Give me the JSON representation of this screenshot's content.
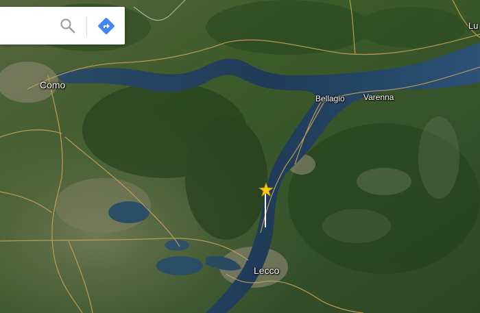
{
  "search": {
    "value": "",
    "placeholder": ""
  },
  "map": {
    "labels": {
      "como": "Como",
      "bellagio": "Bellagio",
      "varenna": "Varenna",
      "lecco": "Lecco",
      "lu": "Lu"
    },
    "colors": {
      "water": "#1f3a55",
      "terrain": "#3e5a2c",
      "roads": "#c9a35a",
      "marker": "#f5c518"
    }
  }
}
